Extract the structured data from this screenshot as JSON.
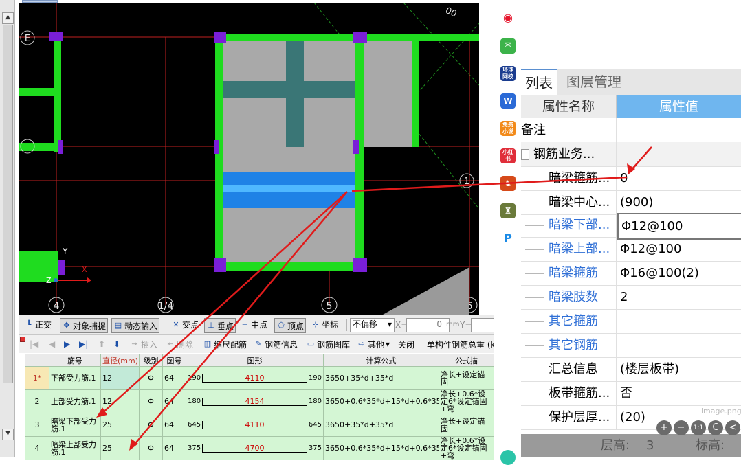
{
  "canvas": {
    "axis_labels": {
      "e": "E",
      "one_mid": "1",
      "x_1": "4",
      "x_2": "1/4",
      "x_3": "5",
      "x_4": "6",
      "corner": "00"
    },
    "ucs": {
      "y": "Y",
      "x": "X",
      "z": "Z"
    }
  },
  "toolbar1": {
    "ortho": "正交",
    "snap": "对象捕捉",
    "dyninput": "动态输入",
    "intersect": "交点",
    "perp": "垂点",
    "midpoint": "中点",
    "vertex": "顶点",
    "coord": "坐标",
    "offset_select": "不偏移",
    "x_label": "X=",
    "x_value": "0",
    "unit": "mm",
    "y_label": "Y="
  },
  "toolbar2": {
    "insert": "插入",
    "delete": "删除",
    "scale_rebar": "缩尺配筋",
    "rebar_info": "钢筋信息",
    "rebar_lib": "钢筋图库",
    "other": "其他",
    "close": "关闭",
    "total": "单构件钢筋总重 (k"
  },
  "table": {
    "headers": [
      "",
      "筋号",
      "直径(mm)",
      "级别",
      "图号",
      "图形",
      "计算公式",
      "公式描"
    ],
    "rows": [
      {
        "no": "1*",
        "name": "下部受力筋.1",
        "dia": "12",
        "grade": "Φ",
        "fig": "64",
        "left": "190",
        "len": "4110",
        "right": "190",
        "formula": "3650+35*d+35*d",
        "desc": "净长+设定锚固"
      },
      {
        "no": "2",
        "name": "上部受力筋.1",
        "dia": "12",
        "grade": "Φ",
        "fig": "64",
        "left": "180",
        "len": "4154",
        "right": "180",
        "formula": "3650+0.6*35*d+15*d+0.6*35*d+15*d",
        "desc": "净长+0.6*设定6*设定锚固+弯"
      },
      {
        "no": "3",
        "name": "暗梁下部受力筋.1",
        "dia": "25",
        "grade": "Φ",
        "fig": "64",
        "left": "645",
        "len": "4110",
        "right": "645",
        "formula": "3650+35*d+35*d",
        "desc": "净长+设定锚固"
      },
      {
        "no": "4",
        "name": "暗梁上部受力筋.1",
        "dia": "25",
        "grade": "Φ",
        "fig": "64",
        "left": "375",
        "len": "4700",
        "right": "375",
        "formula": "3650+0.6*35*d+15*d+0.6*35*d+15*d",
        "desc": "净长+0.6*设定6*设定锚固+弯"
      }
    ]
  },
  "strip": {
    "icons": [
      "weibo-icon",
      "mail-icon",
      "huanqiu-icon",
      "word-doc-icon",
      "novel-icon",
      "xiaohongshu-icon",
      "game-icon",
      "game2-icon",
      "pixiv-icon"
    ],
    "huanqiu_text": "环球网校",
    "novel_text": "免费小说",
    "xhs_text": "小红书"
  },
  "panel": {
    "tab_active": "列表",
    "tab_other": "图层管理",
    "col_name": "属性名称",
    "col_value": "属性值",
    "rows": [
      {
        "name": "备注",
        "value": ""
      },
      {
        "name": "钢筋业务...",
        "value": ""
      },
      {
        "name": "暗梁箍筋...",
        "value": "0"
      },
      {
        "name": "暗梁中心...",
        "value": "(900)"
      },
      {
        "name": "暗梁下部...",
        "value": "Φ12@100"
      },
      {
        "name": "暗梁上部...",
        "value": "Φ12@100"
      },
      {
        "name": "暗梁箍筋",
        "value": "Φ16@100(2)"
      },
      {
        "name": "暗梁肢数",
        "value": "2"
      },
      {
        "name": "其它箍筋",
        "value": ""
      },
      {
        "name": "其它钢筋",
        "value": ""
      },
      {
        "name": "汇总信息",
        "value": "(楼层板带)"
      },
      {
        "name": "板带箍筋...",
        "value": "否"
      },
      {
        "name": "保护层厚...",
        "value": "(20)"
      }
    ],
    "status_left": "层高:",
    "status_val": "3",
    "status_right": "标高:",
    "watermark": "image.png",
    "zoom_buttons": [
      "+",
      "−",
      "1:1",
      "C",
      "<"
    ]
  },
  "colors": {
    "wall_green": "#1fdc1f",
    "slab_gray": "#a9a9a9",
    "band_teal": "#3a7676",
    "band_blue": "#1f82e6",
    "grid_red": "#c02020",
    "arrow_red": "#e01b1b",
    "accent_blue": "#6fb6ef"
  }
}
